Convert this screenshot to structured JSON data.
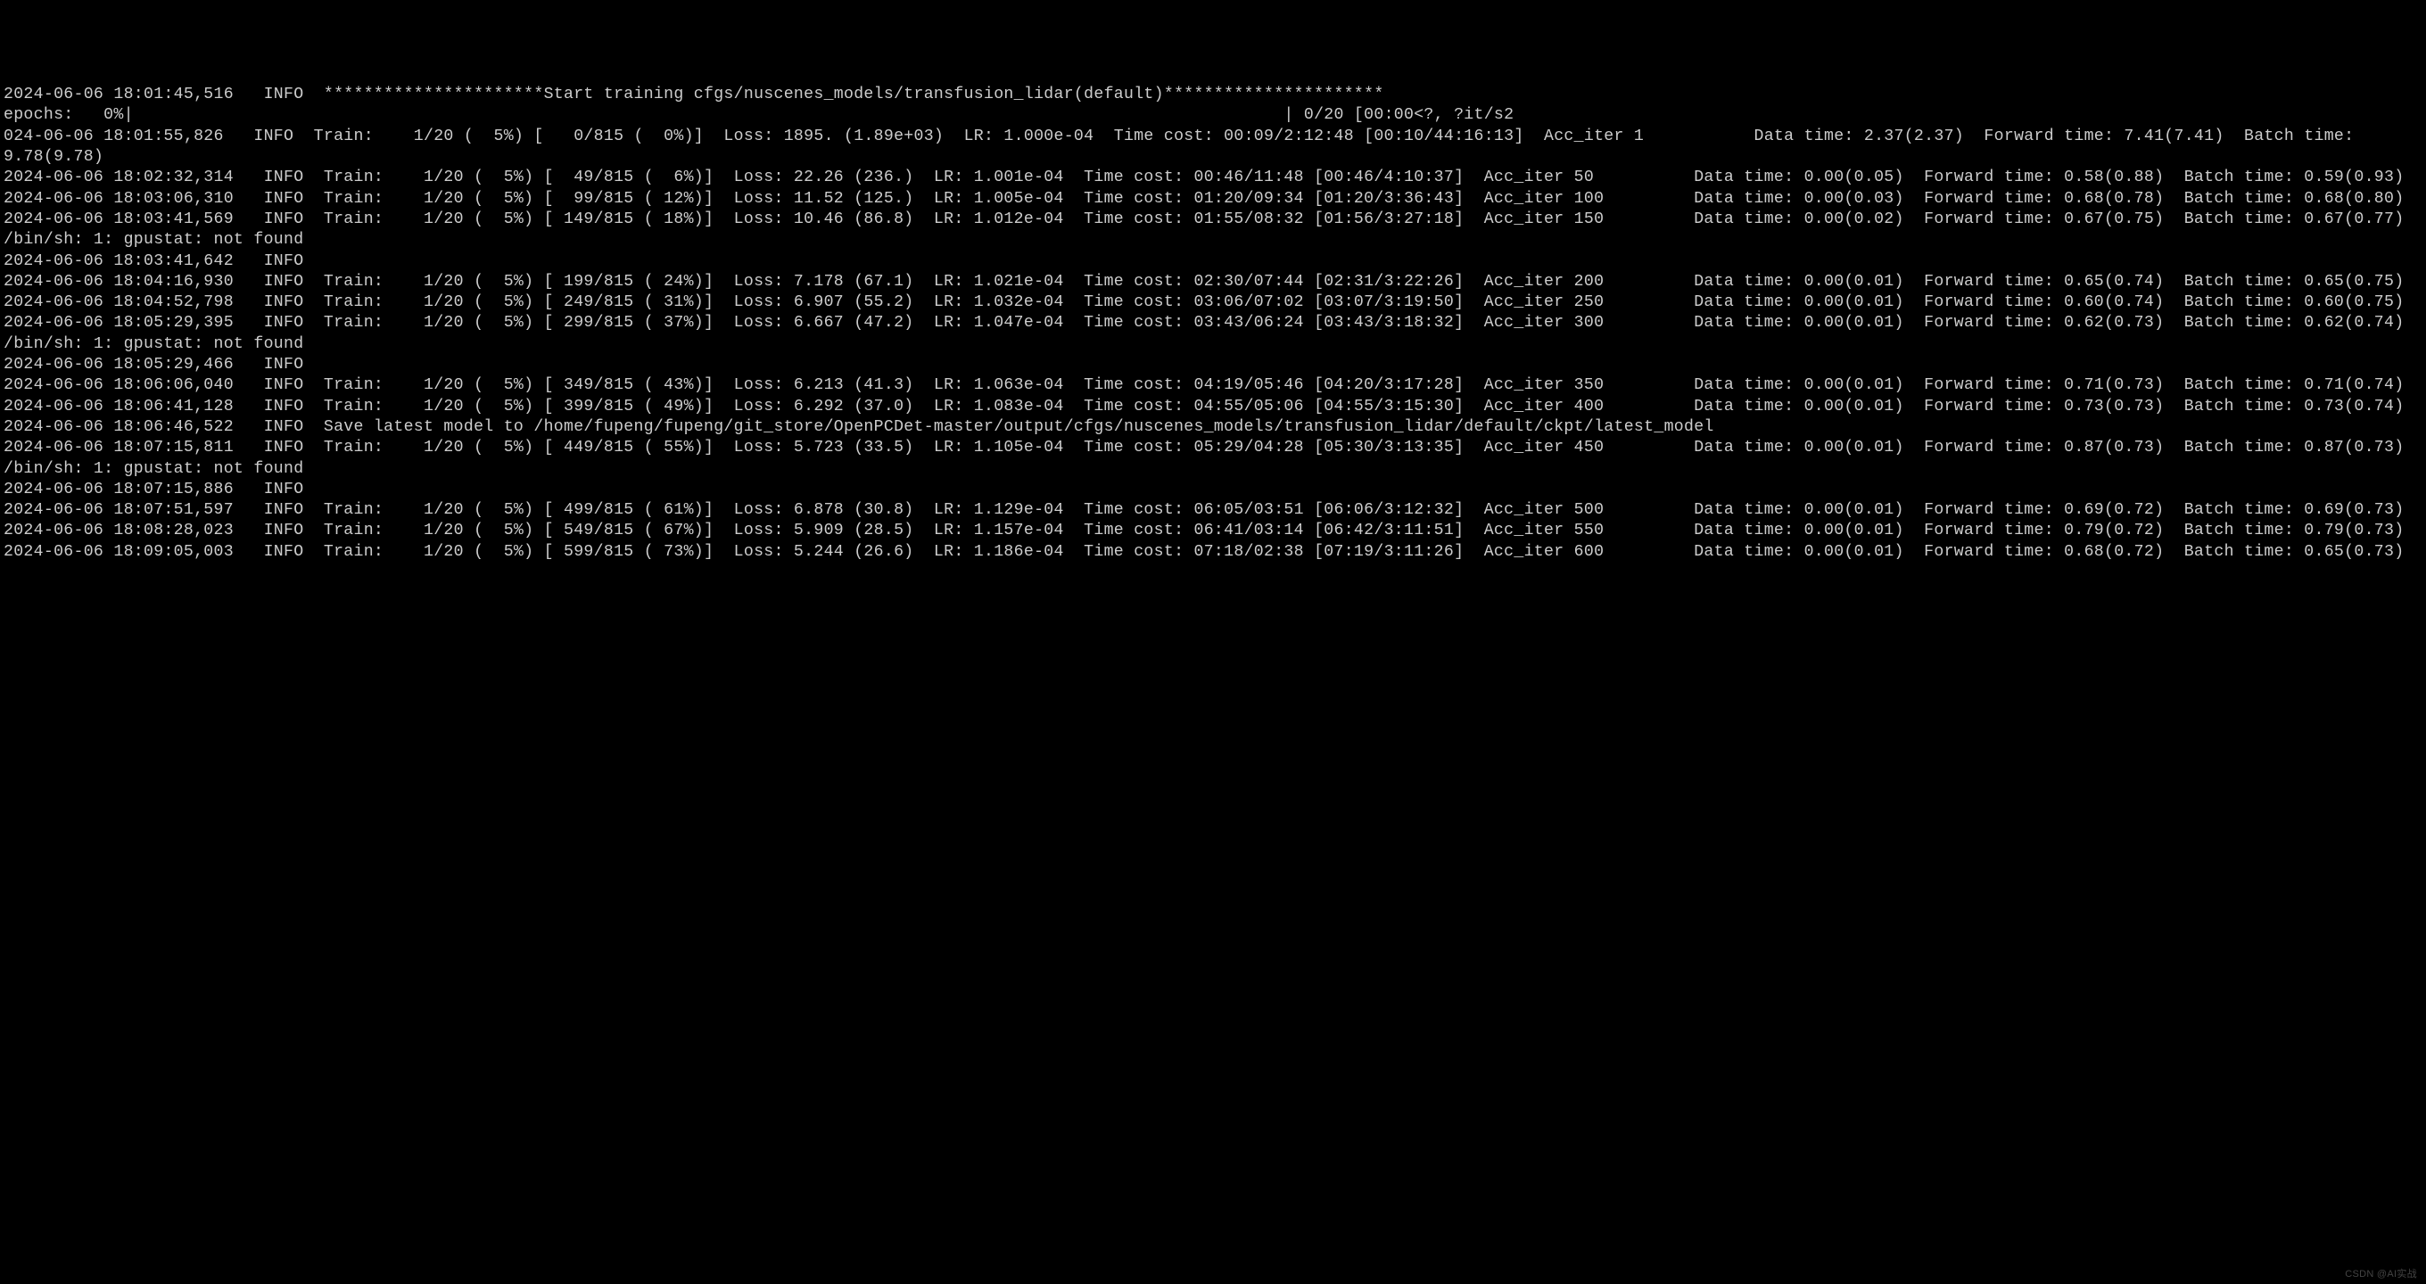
{
  "watermark": "CSDN @AI实战",
  "lines": [
    "2024-06-06 18:01:45,516   INFO  **********************Start training cfgs/nuscenes_models/transfusion_lidar(default)**********************",
    "epochs:   0%|                                                                                                                   | 0/20 [00:00<?, ?it/s2",
    "024-06-06 18:01:55,826   INFO  Train:    1/20 (  5%) [   0/815 (  0%)]  Loss: 1895. (1.89e+03)  LR: 1.000e-04  Time cost: 00:09/2:12:48 [00:10/44:16:13]  Acc_iter 1           Data time: 2.37(2.37)  Forward time: 7.41(7.41)  Batch time: 9.78(9.78)",
    "2024-06-06 18:02:32,314   INFO  Train:    1/20 (  5%) [  49/815 (  6%)]  Loss: 22.26 (236.)  LR: 1.001e-04  Time cost: 00:46/11:48 [00:46/4:10:37]  Acc_iter 50          Data time: 0.00(0.05)  Forward time: 0.58(0.88)  Batch time: 0.59(0.93)",
    "2024-06-06 18:03:06,310   INFO  Train:    1/20 (  5%) [  99/815 ( 12%)]  Loss: 11.52 (125.)  LR: 1.005e-04  Time cost: 01:20/09:34 [01:20/3:36:43]  Acc_iter 100         Data time: 0.00(0.03)  Forward time: 0.68(0.78)  Batch time: 0.68(0.80)",
    "2024-06-06 18:03:41,569   INFO  Train:    1/20 (  5%) [ 149/815 ( 18%)]  Loss: 10.46 (86.8)  LR: 1.012e-04  Time cost: 01:55/08:32 [01:56/3:27:18]  Acc_iter 150         Data time: 0.00(0.02)  Forward time: 0.67(0.75)  Batch time: 0.67(0.77)",
    "/bin/sh: 1: gpustat: not found",
    "2024-06-06 18:03:41,642   INFO",
    "2024-06-06 18:04:16,930   INFO  Train:    1/20 (  5%) [ 199/815 ( 24%)]  Loss: 7.178 (67.1)  LR: 1.021e-04  Time cost: 02:30/07:44 [02:31/3:22:26]  Acc_iter 200         Data time: 0.00(0.01)  Forward time: 0.65(0.74)  Batch time: 0.65(0.75)",
    "2024-06-06 18:04:52,798   INFO  Train:    1/20 (  5%) [ 249/815 ( 31%)]  Loss: 6.907 (55.2)  LR: 1.032e-04  Time cost: 03:06/07:02 [03:07/3:19:50]  Acc_iter 250         Data time: 0.00(0.01)  Forward time: 0.60(0.74)  Batch time: 0.60(0.75)",
    "2024-06-06 18:05:29,395   INFO  Train:    1/20 (  5%) [ 299/815 ( 37%)]  Loss: 6.667 (47.2)  LR: 1.047e-04  Time cost: 03:43/06:24 [03:43/3:18:32]  Acc_iter 300         Data time: 0.00(0.01)  Forward time: 0.62(0.73)  Batch time: 0.62(0.74)",
    "/bin/sh: 1: gpustat: not found",
    "2024-06-06 18:05:29,466   INFO",
    "2024-06-06 18:06:06,040   INFO  Train:    1/20 (  5%) [ 349/815 ( 43%)]  Loss: 6.213 (41.3)  LR: 1.063e-04  Time cost: 04:19/05:46 [04:20/3:17:28]  Acc_iter 350         Data time: 0.00(0.01)  Forward time: 0.71(0.73)  Batch time: 0.71(0.74)",
    "2024-06-06 18:06:41,128   INFO  Train:    1/20 (  5%) [ 399/815 ( 49%)]  Loss: 6.292 (37.0)  LR: 1.083e-04  Time cost: 04:55/05:06 [04:55/3:15:30]  Acc_iter 400         Data time: 0.00(0.01)  Forward time: 0.73(0.73)  Batch time: 0.73(0.74)",
    "2024-06-06 18:06:46,522   INFO  Save latest model to /home/fupeng/fupeng/git_store/OpenPCDet-master/output/cfgs/nuscenes_models/transfusion_lidar/default/ckpt/latest_model",
    "2024-06-06 18:07:15,811   INFO  Train:    1/20 (  5%) [ 449/815 ( 55%)]  Loss: 5.723 (33.5)  LR: 1.105e-04  Time cost: 05:29/04:28 [05:30/3:13:35]  Acc_iter 450         Data time: 0.00(0.01)  Forward time: 0.87(0.73)  Batch time: 0.87(0.73)",
    "/bin/sh: 1: gpustat: not found",
    "2024-06-06 18:07:15,886   INFO",
    "2024-06-06 18:07:51,597   INFO  Train:    1/20 (  5%) [ 499/815 ( 61%)]  Loss: 6.878 (30.8)  LR: 1.129e-04  Time cost: 06:05/03:51 [06:06/3:12:32]  Acc_iter 500         Data time: 0.00(0.01)  Forward time: 0.69(0.72)  Batch time: 0.69(0.73)",
    "2024-06-06 18:08:28,023   INFO  Train:    1/20 (  5%) [ 549/815 ( 67%)]  Loss: 5.909 (28.5)  LR: 1.157e-04  Time cost: 06:41/03:14 [06:42/3:11:51]  Acc_iter 550         Data time: 0.00(0.01)  Forward time: 0.79(0.72)  Batch time: 0.79(0.73)",
    "2024-06-06 18:09:05,003   INFO  Train:    1/20 (  5%) [ 599/815 ( 73%)]  Loss: 5.244 (26.6)  LR: 1.186e-04  Time cost: 07:18/02:38 [07:19/3:11:26]  Acc_iter 600         Data time: 0.00(0.01)  Forward time: 0.68(0.72)  Batch time: 0.65(0.73)"
  ]
}
